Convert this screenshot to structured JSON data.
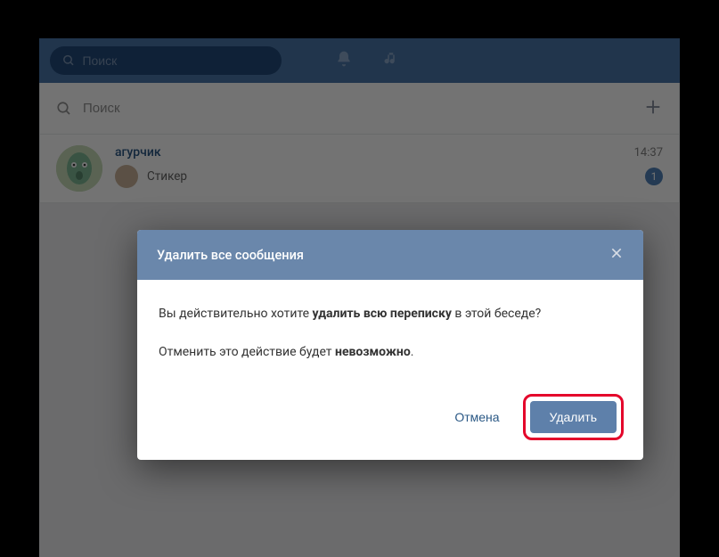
{
  "topbar": {
    "search_placeholder": "Поиск"
  },
  "chat_search": {
    "placeholder": "Поиск"
  },
  "chat": {
    "name": "агурчик",
    "time": "14:37",
    "preview": "Стикер",
    "badge": "1"
  },
  "dialog": {
    "title": "Удалить все сообщения",
    "line1_a": "Вы действительно хотите ",
    "line1_b": "удалить всю переписку",
    "line1_c": " в этой беседе?",
    "line2_a": "Отменить это действие будет ",
    "line2_b": "невозможно",
    "line2_c": ".",
    "cancel": "Отмена",
    "confirm": "Удалить"
  }
}
